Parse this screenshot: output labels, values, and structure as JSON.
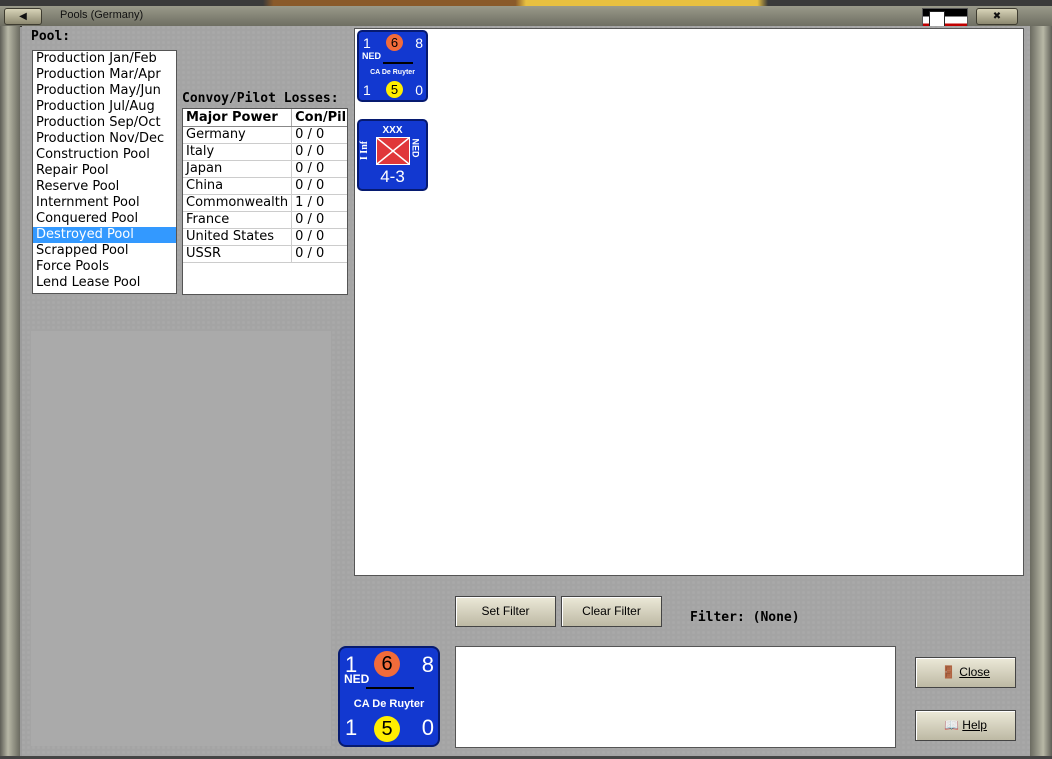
{
  "window": {
    "title": "Pools (Germany)"
  },
  "pool_panel": {
    "label": "Pool:",
    "items": [
      "Production Jan/Feb",
      "Production Mar/Apr",
      "Production May/Jun",
      "Production Jul/Aug",
      "Production Sep/Oct",
      "Production Nov/Dec",
      "Construction Pool",
      "Repair Pool",
      "Reserve Pool",
      "Internment Pool",
      "Conquered Pool",
      "Destroyed Pool",
      "Scrapped Pool",
      "Force Pools",
      "Lend Lease Pool"
    ],
    "selected": "Destroyed Pool"
  },
  "losses": {
    "label": "Convoy/Pilot Losses:",
    "headers": [
      "Major Power",
      "Con/Pil"
    ],
    "rows": [
      [
        "Germany",
        "0 / 0"
      ],
      [
        "Italy",
        "0 / 0"
      ],
      [
        "Japan",
        "0 / 0"
      ],
      [
        "China",
        "0 / 0"
      ],
      [
        "Commonwealth",
        "1 / 0"
      ],
      [
        "France",
        "0 / 0"
      ],
      [
        "United States",
        "0 / 0"
      ],
      [
        "USSR",
        "0 / 0"
      ]
    ]
  },
  "units": {
    "ship": {
      "top_left": "1",
      "attack": "6",
      "top_right": "8",
      "nation": "NED",
      "name": "CA De Ruyter",
      "bottom_left": "1",
      "aa": "5",
      "bottom_right": "0"
    },
    "infantry": {
      "size": "XXX",
      "type": "I Inf",
      "nation": "NED",
      "strength": "4-3"
    }
  },
  "filter": {
    "set_label": "Set Filter",
    "clear_label": "Clear Filter",
    "filter_text": "Filter:  (None)"
  },
  "buttons": {
    "close": "Close",
    "help": "Help"
  },
  "colors": {
    "counter_blue": "#1238d0",
    "attack_circle": "#f26b3a",
    "aa_circle": "#ffee00",
    "selection": "#3399ff"
  }
}
